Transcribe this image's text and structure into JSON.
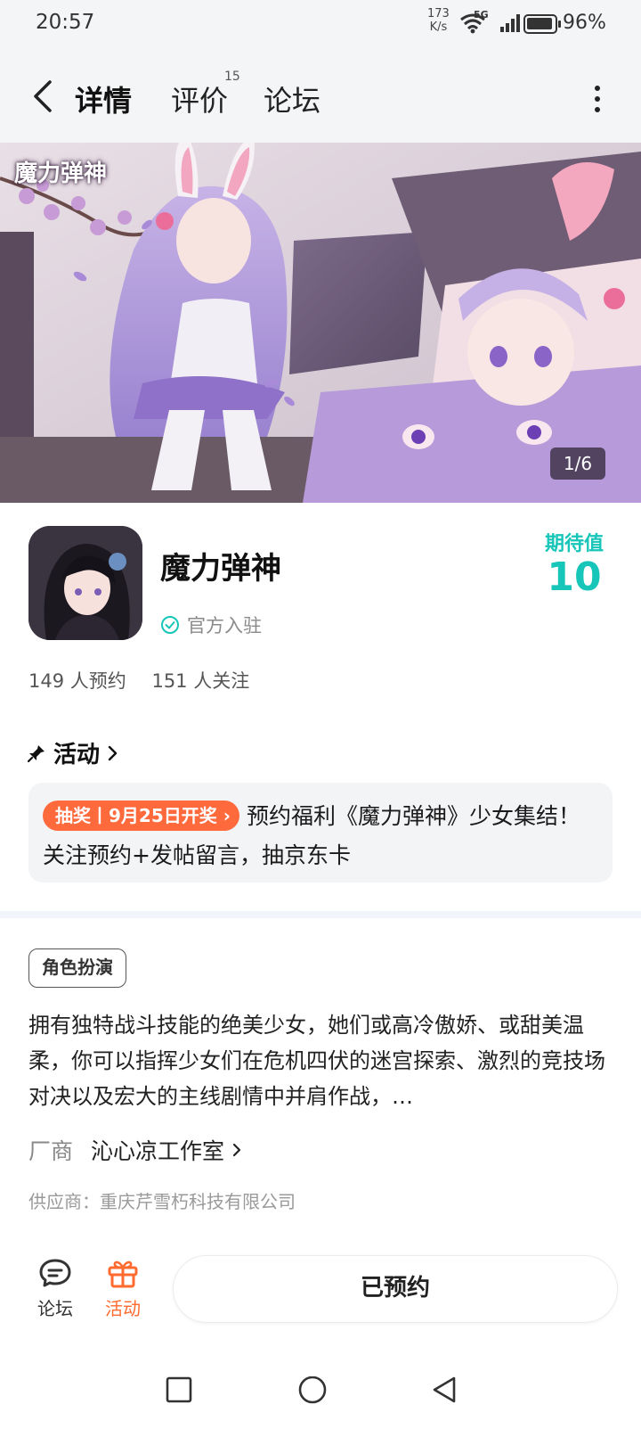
{
  "status_bar": {
    "time": "20:57",
    "net_speed_value": "173",
    "net_speed_unit": "K/s",
    "network": "5G",
    "battery": "96%"
  },
  "nav": {
    "tabs": [
      {
        "label": "详情",
        "active": true
      },
      {
        "label": "评价",
        "badge": "15"
      },
      {
        "label": "论坛"
      }
    ]
  },
  "banner": {
    "logo_text": "魔力弹神",
    "counter": "1/6"
  },
  "game": {
    "title": "魔力弹神",
    "official_label": "官方入驻",
    "expect_label": "期待值",
    "expect_value": "10",
    "reservations": "149 人预约",
    "followers": "151 人关注"
  },
  "activity": {
    "section_title": "活动",
    "badge": "抽奖丨9月25日开奖",
    "text": "预约福利《魔力弹神》少女集结！关注预约+发帖留言，抽京东卡"
  },
  "details": {
    "tag": "角色扮演",
    "description": "拥有独特战斗技能的绝美少女，她们或高冷傲娇、或甜美温柔，你可以指挥少女们在危机四伏的迷宫探索、激烈的竞技场对决以及宏大的主线剧情中并肩作战，…",
    "vendor_label": "厂商",
    "vendor_name": "沁心凉工作室",
    "supplier": "供应商：重庆芹雪朽科技有限公司"
  },
  "bottom_bar": {
    "forum_label": "论坛",
    "activity_label": "活动",
    "reserved_button": "已预约"
  },
  "colors": {
    "accent_teal": "#17c6b8",
    "accent_orange": "#ff6a3d",
    "background": "#ffffff"
  }
}
